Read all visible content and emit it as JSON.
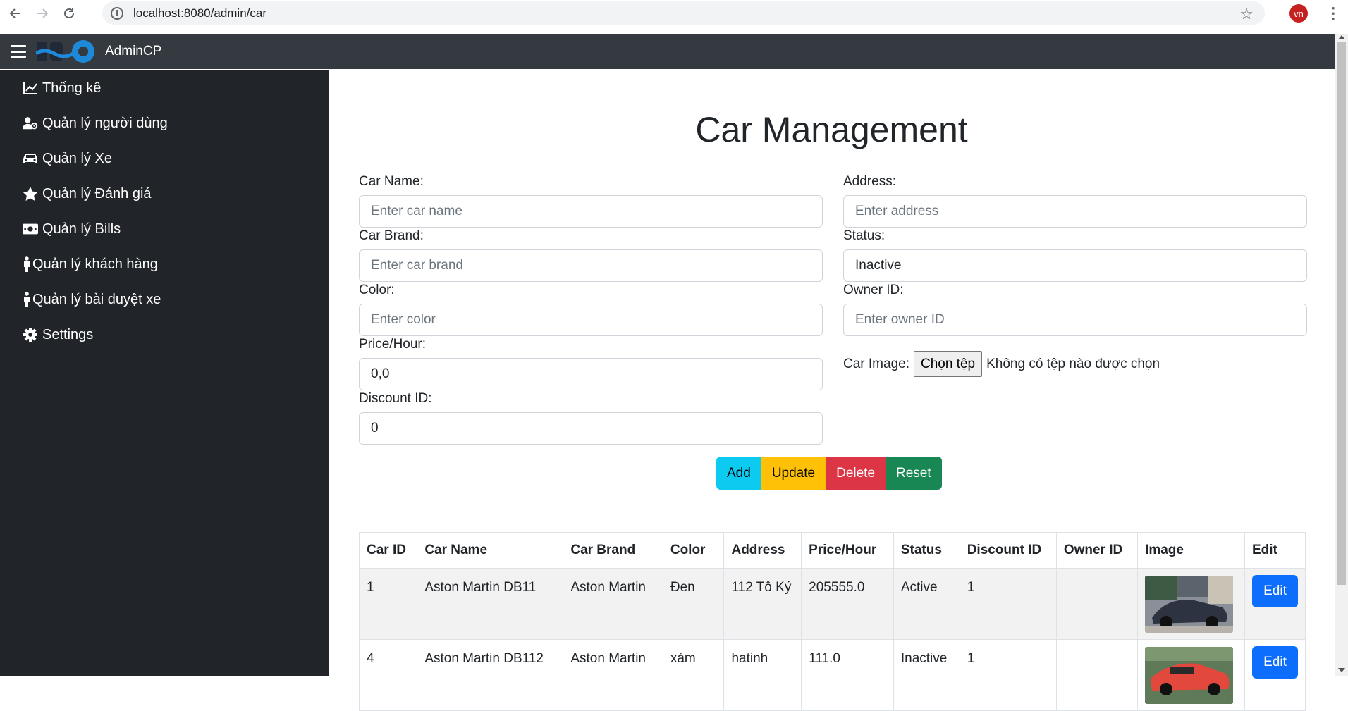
{
  "browser": {
    "url": "localhost:8080/admin/car",
    "profile_initials": "vn"
  },
  "topbar": {
    "brand": "AdminCP"
  },
  "sidebar": {
    "items": [
      {
        "label": "Thống kê",
        "icon": "chart-line-icon"
      },
      {
        "label": "Quản lý người dùng",
        "icon": "user-gear-icon"
      },
      {
        "label": "Quản lý Xe",
        "icon": "car-icon"
      },
      {
        "label": "Quản lý Đánh giá",
        "icon": "star-icon"
      },
      {
        "label": "Quản lý Bills",
        "icon": "money-bill-icon"
      },
      {
        "label": "Quản lý khách hàng",
        "icon": "person-icon"
      },
      {
        "label": "Quản lý bài duyệt xe",
        "icon": "person-icon"
      },
      {
        "label": "Settings",
        "icon": "gear-icon"
      }
    ]
  },
  "main": {
    "title": "Car Management",
    "form": {
      "car_name": {
        "label": "Car Name:",
        "placeholder": "Enter car name"
      },
      "car_brand": {
        "label": "Car Brand:",
        "placeholder": "Enter car brand"
      },
      "color": {
        "label": "Color:",
        "placeholder": "Enter color"
      },
      "price_hour": {
        "label": "Price/Hour:",
        "value": "0,0"
      },
      "discount_id": {
        "label": "Discount ID:",
        "value": "0"
      },
      "address": {
        "label": "Address:",
        "placeholder": "Enter address"
      },
      "status": {
        "label": "Status:",
        "value": "Inactive"
      },
      "owner_id": {
        "label": "Owner ID:",
        "placeholder": "Enter owner ID"
      },
      "car_image": {
        "label": "Car Image:",
        "button": "Chọn tệp",
        "no_file": "Không có tệp nào được chọn"
      }
    },
    "buttons": {
      "add": "Add",
      "update": "Update",
      "delete": "Delete",
      "reset": "Reset"
    },
    "table": {
      "headers": [
        "Car ID",
        "Car Name",
        "Car Brand",
        "Color",
        "Address",
        "Price/Hour",
        "Status",
        "Discount ID",
        "Owner ID",
        "Image",
        "Edit"
      ],
      "rows": [
        {
          "id": "1",
          "name": "Aston Martin DB11",
          "brand": "Aston Martin",
          "color": "Đen",
          "address": "112 Tô Ký",
          "price": "205555.0",
          "status": "Active",
          "discount": "1",
          "owner": "",
          "edit": "Edit"
        },
        {
          "id": "4",
          "name": "Aston Martin DB112",
          "brand": "Aston Martin",
          "color": "xám",
          "address": "hatinh",
          "price": "111.0",
          "status": "Inactive",
          "discount": "1",
          "owner": "",
          "edit": "Edit"
        }
      ]
    }
  }
}
